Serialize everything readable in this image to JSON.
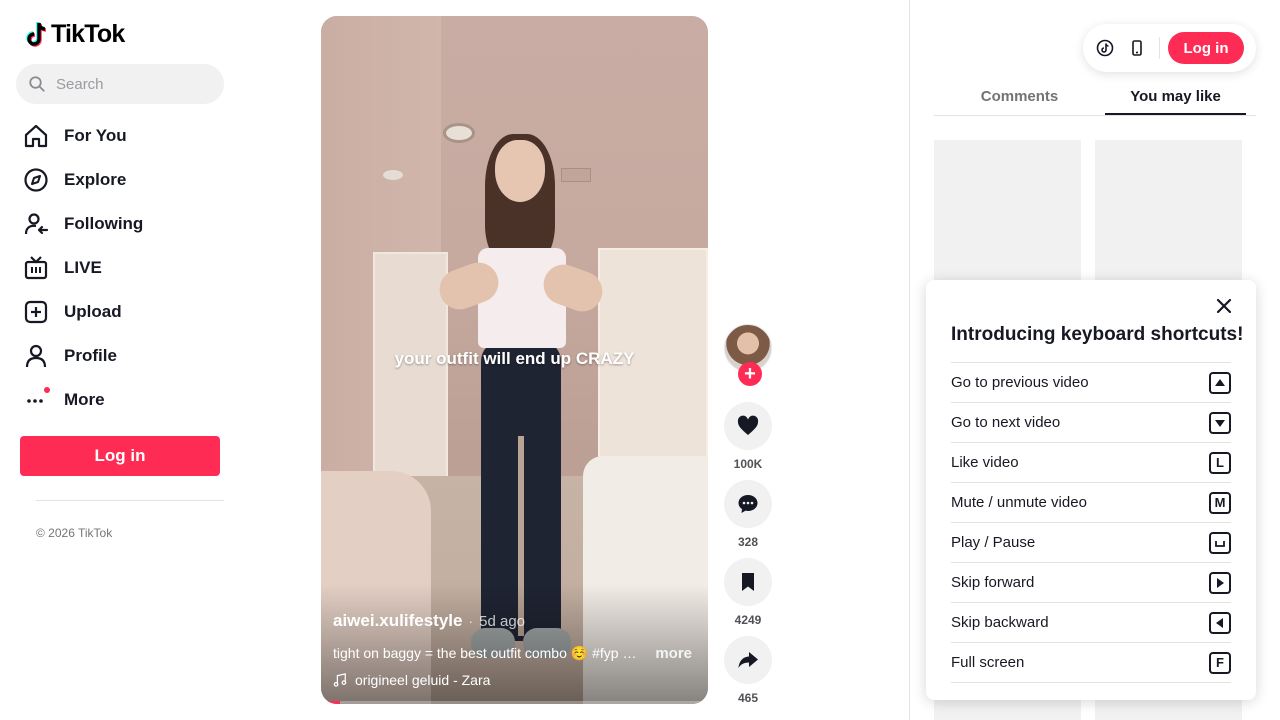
{
  "brand": {
    "name": "TikTok"
  },
  "search": {
    "placeholder": "Search"
  },
  "nav": {
    "items": [
      {
        "label": "For You",
        "icon": "home-icon"
      },
      {
        "label": "Explore",
        "icon": "compass-icon"
      },
      {
        "label": "Following",
        "icon": "following-icon"
      },
      {
        "label": "LIVE",
        "icon": "live-tv-icon"
      },
      {
        "label": "Upload",
        "icon": "upload-plus-icon"
      },
      {
        "label": "Profile",
        "icon": "person-icon"
      },
      {
        "label": "More",
        "icon": "more-dots-icon"
      }
    ]
  },
  "sidebar": {
    "login_label": "Log in",
    "copyright": "© 2026 TikTok"
  },
  "video": {
    "overlay_text": "your outfit will end up CRAZY",
    "author": "aiwei.xulifestyle",
    "separator": "·",
    "posted": "5d ago",
    "description": "tight on baggy = the best outfit combo ☺️ #fyp #outfit",
    "more_label": "more",
    "music": "origineel geluid - Zara",
    "progress": 0.05
  },
  "actions": {
    "likes": "100K",
    "comments": "328",
    "saves": "4249",
    "shares": "465"
  },
  "header": {
    "login_label": "Log in"
  },
  "tabs": [
    {
      "label": "Comments",
      "active": false
    },
    {
      "label": "You may like",
      "active": true
    }
  ],
  "shortcuts": {
    "title": "Introducing keyboard shortcuts!",
    "items": [
      {
        "label": "Go to previous video",
        "key": "arrow-up-key-icon"
      },
      {
        "label": "Go to next video",
        "key": "arrow-down-key-icon"
      },
      {
        "label": "Like video",
        "key": "L"
      },
      {
        "label": "Mute / unmute video",
        "key": "M"
      },
      {
        "label": "Play / Pause",
        "key": "space-key-icon"
      },
      {
        "label": "Skip forward",
        "key": "arrow-right-key-icon"
      },
      {
        "label": "Skip backward",
        "key": "arrow-left-key-icon"
      },
      {
        "label": "Full screen",
        "key": "F"
      }
    ]
  },
  "colors": {
    "accent": "#fe2c55",
    "text": "#161823",
    "muted": "#f1f1f2"
  }
}
